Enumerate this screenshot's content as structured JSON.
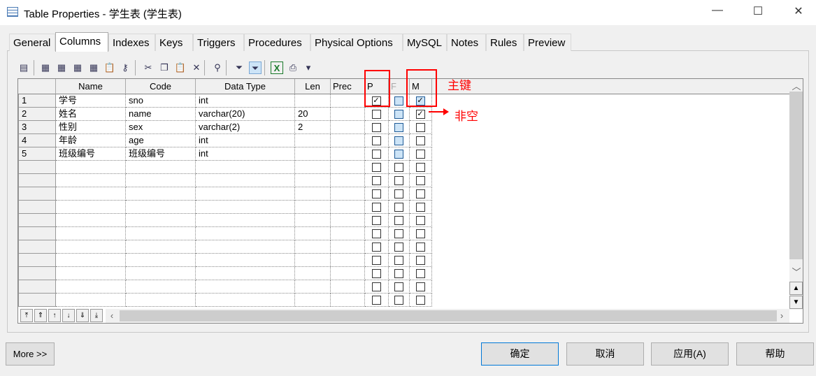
{
  "window": {
    "title": "Table Properties - 学生表 (学生表)",
    "minimize": "—",
    "maximize": "☐",
    "close": "✕"
  },
  "tabs": [
    "General",
    "Columns",
    "Indexes",
    "Keys",
    "Triggers",
    "Procedures",
    "Physical Options",
    "MySQL",
    "Notes",
    "Rules",
    "Preview"
  ],
  "active_tab": "Columns",
  "toolbar": [
    "properties-icon",
    "insert-row-icon",
    "add-row-icon",
    "add-columns-icon",
    "reuse-columns-icon",
    "paste-icon",
    "key-icon",
    "cut-icon",
    "copy-icon",
    "paste-icon",
    "delete-icon",
    "find-icon",
    "filter-icon",
    "enable-filter-icon",
    "excel-icon",
    "print-icon",
    "dropdown-icon"
  ],
  "grid": {
    "headers": [
      "Name",
      "Code",
      "Data Type",
      "Len",
      "Prec",
      "P",
      "F",
      "M"
    ],
    "rows": [
      {
        "n": "1",
        "name": "学号",
        "code": "sno",
        "type": "int",
        "len": "",
        "prec": "",
        "p": true,
        "f": false,
        "m": true
      },
      {
        "n": "2",
        "name": "姓名",
        "code": "name",
        "type": "varchar(20)",
        "len": "20",
        "prec": "",
        "p": false,
        "f": false,
        "m": true
      },
      {
        "n": "3",
        "name": "性别",
        "code": "sex",
        "type": "varchar(2)",
        "len": "2",
        "prec": "",
        "p": false,
        "f": false,
        "m": false
      },
      {
        "n": "4",
        "name": "年龄",
        "code": "age",
        "type": "int",
        "len": "",
        "prec": "",
        "p": false,
        "f": false,
        "m": false
      },
      {
        "n": "5",
        "name": "班级编号",
        "code": "班级编号",
        "type": "int",
        "len": "",
        "prec": "",
        "p": false,
        "f": false,
        "m": false
      }
    ]
  },
  "annotations": {
    "primary_key": "主键",
    "not_null": "非空"
  },
  "buttons": {
    "more": "More >>",
    "ok": "确定",
    "cancel": "取消",
    "apply": "应用(A)",
    "help": "帮助"
  }
}
